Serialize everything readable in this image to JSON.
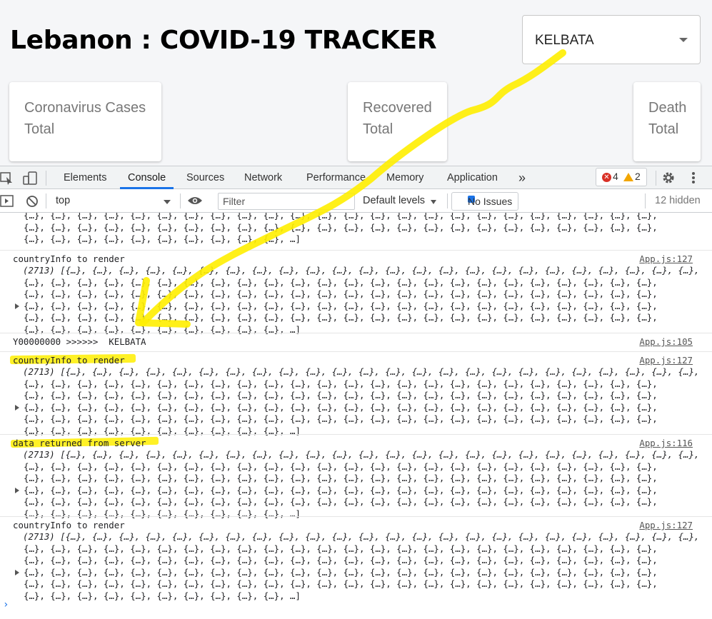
{
  "app": {
    "title": "Lebanon : COVID-19 TRACKER",
    "region_select": {
      "value": "KELBATA"
    },
    "cards": [
      {
        "title": "Coronavirus Cases",
        "subtitle": "Total"
      },
      {
        "title": "Recovered",
        "subtitle": "Total"
      },
      {
        "title": "Death",
        "subtitle": "Total"
      }
    ]
  },
  "devtools": {
    "tabs": [
      "Elements",
      "Console",
      "Sources",
      "Network",
      "Performance",
      "Memory",
      "Application"
    ],
    "more_tabs": "»",
    "error_count": "4",
    "warning_count": "2",
    "context": "top",
    "filter_placeholder": "Filter",
    "levels": "Default levels",
    "issues": "No Issues",
    "hidden": "12 hidden"
  },
  "console": {
    "obj": "{…}, ",
    "tail": "{…}, {…}, {…}, {…}, {…}, {…}, …]",
    "first": "(2713) [{…}, ",
    "entries": [
      {
        "message": "",
        "source": ""
      },
      {
        "message": "countryInfo to render",
        "source": "App.js:127"
      },
      {
        "message": "Y00000000 >>>>>>  KELBATA",
        "source": "App.js:105"
      },
      {
        "message": "countryInfo to render",
        "source": "App.js:127"
      },
      {
        "message": "data returned from server",
        "source": "App.js:116"
      },
      {
        "message": "countryInfo to render",
        "source": "App.js:127"
      }
    ]
  },
  "colors": {
    "highlight": "#ffee00",
    "accent": "#1a73e8",
    "error": "#d93025",
    "warning": "#f2a600"
  }
}
